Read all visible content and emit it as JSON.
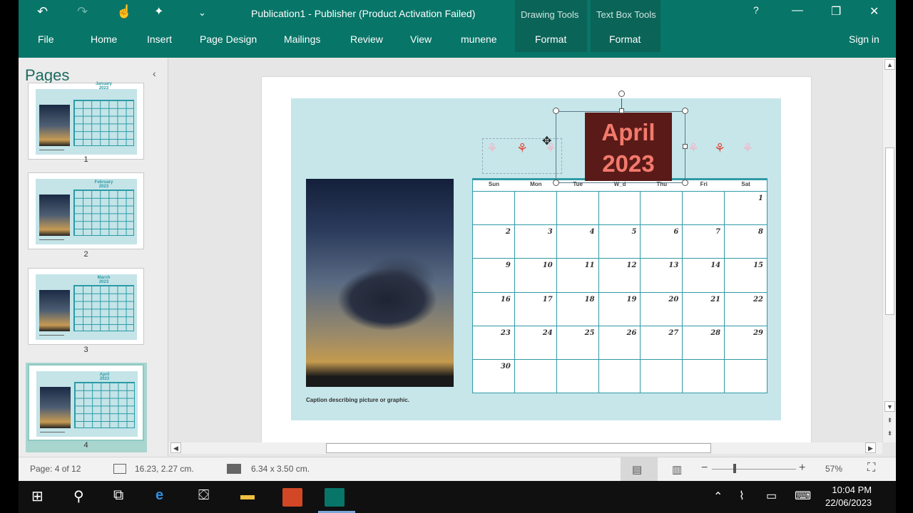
{
  "title_bar": {
    "title": "Publication1 - Publisher (Product Activation Failed)",
    "help": "?",
    "minimize": "—",
    "restore": "❐",
    "close": "✕"
  },
  "quick_access": {
    "undo": "↶",
    "redo": "↷",
    "touch": "☝",
    "customize": "⌄"
  },
  "contextual_groups": [
    {
      "label": "Drawing Tools",
      "tab": "Format"
    },
    {
      "label": "Text Box Tools",
      "tab": "Format"
    }
  ],
  "tabs": [
    "File",
    "Home",
    "Insert",
    "Page Design",
    "Mailings",
    "Review",
    "View",
    "munene"
  ],
  "sign_in": "Sign in",
  "pages_pane": {
    "title": "Pages",
    "collapse": "‹",
    "thumbnails": [
      {
        "number": "1",
        "month": "January\n2023"
      },
      {
        "number": "2",
        "month": "February\n2023"
      },
      {
        "number": "3",
        "month": "March\n2023"
      },
      {
        "number": "4",
        "month": "April\n2023"
      }
    ]
  },
  "calendar": {
    "month_title": "April\n2023",
    "day_names": [
      "Sun",
      "Mon",
      "Tue",
      "W_d",
      "Thu",
      "Fri",
      "Sat"
    ],
    "days": [
      "",
      "",
      "",
      "",
      "",
      "",
      "1",
      "2",
      "3",
      "4",
      "5",
      "6",
      "7",
      "8",
      "9",
      "10",
      "11",
      "12",
      "13",
      "14",
      "15",
      "16",
      "17",
      "18",
      "19",
      "20",
      "21",
      "22",
      "23",
      "24",
      "25",
      "26",
      "27",
      "28",
      "29",
      "30",
      "",
      "",
      "",
      "",
      "",
      ""
    ],
    "caption": "Caption describing picture or graphic."
  },
  "status_bar": {
    "page": "Page: 4 of 12",
    "position": "16.23, 2.27 cm.",
    "size": "6.34 x  3.50 cm.",
    "zoom_minus": "−",
    "zoom_plus": "+",
    "zoom": "57%",
    "fit_icon": "⛶"
  },
  "taskbar": {
    "time": "10:04 PM",
    "date": "22/06/2023"
  },
  "colors": {
    "ribbon": "#077568",
    "calendar_bg": "#c6e6ea",
    "month_box": "#5a1a18",
    "month_text": "#f27a6c"
  }
}
